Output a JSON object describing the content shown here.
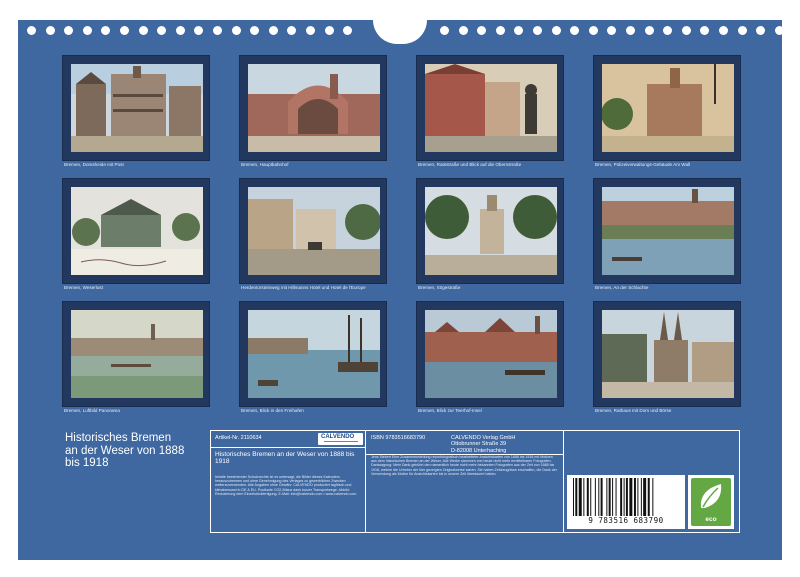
{
  "colors": {
    "sheet": "#3f67a0",
    "frame": "#22385f",
    "text": "#ffffff",
    "eco_green": "#63a842"
  },
  "photos": [
    {
      "caption": "Bremen, Domsheide mit Post",
      "icon": "photo-domsheide"
    },
    {
      "caption": "Bremen, Hauptbahnhof",
      "icon": "photo-hauptbahnhof"
    },
    {
      "caption": "Bremen, Ratsstraße und Blick auf die Obernstraße",
      "icon": "photo-obernstrasse"
    },
    {
      "caption": "Bremen, Polizeiverwaltungs-Gebäude Am Wall",
      "icon": "photo-polizei"
    },
    {
      "caption": "Bremen, Weserlust",
      "icon": "photo-weserlust"
    },
    {
      "caption": "Herdentorsteinweg mit Hillmanns Hotel und Hotel de l'Europe",
      "icon": "photo-herdentor"
    },
    {
      "caption": "Bremen, Sögestraße",
      "icon": "photo-soegestrasse"
    },
    {
      "caption": "Bremen, An der Schlachte",
      "icon": "photo-schlachte"
    },
    {
      "caption": "Bremen, Luftbild Panorama",
      "icon": "photo-panorama"
    },
    {
      "caption": "Bremen, Blick in den Freihafen",
      "icon": "photo-freihafen"
    },
    {
      "caption": "Bremen, Blick zur Teerhof-Insel",
      "icon": "photo-teerhof"
    },
    {
      "caption": "Bremen, Rathaus mit Dom und Börse",
      "icon": "photo-rathaus"
    }
  ],
  "title_lines": [
    "Historisches Bremen",
    "an der Weser von 1888",
    "bis 1918"
  ],
  "info": {
    "article": "Artikel-Nr. 2110634",
    "logo": "CALVENDO",
    "small_title": "Historisches Bremen an der Weser von 1888 bis 1918",
    "fine_print": "Inhalte bestehender Schutzrechte ist es untersagt, die Bilder dieses Kalenders herauszutrennen und ohne Genehmigung des Verlages zu gewerblichen Zwecken weiterzuverwenden. Alle Angaben ohne Gewähr. CALVENDO produziert tagfrisch und klimabewusst in DE & EU. Postkarte CO2-Bilanz dank kurzer Transportwege. Abbild: Reduzierung dem Einzelstückfertigung. E-Mail: info@calvendo.com • www.calvendo.com",
    "isbn": "ISBN 9783516683790",
    "publisher_lines": [
      "CALVENDO Verlag GmbH",
      "Ottobrunner Straße 39",
      "D-82008 Unterhaching"
    ],
    "credit": "Jens Siebert Eine Zusammenstellung reprofotografisch bearbeiteter Ansichtskarten von 1888 bis 1918 mit Motiven aus dem historischen Bremen an der Weser. Alle Werke stammen von heute nicht mehr ermittelbaren Fotografen. Danksagung: Mein Dank gebührt den namentlich heute nicht mehr bekannten Fotografen aus der Zeit von 1888 bis 1918, welche die Urheber der hier gezeigten Originalwerke waren. Sie haben Zeitzeugnisse erschaffen, die Dank der Verwendung als Motive für Ansichtskarten bis in unsere Zeit überdauert haben.",
    "barcode_number": "9 783516 683790",
    "eco_label": "eco"
  }
}
